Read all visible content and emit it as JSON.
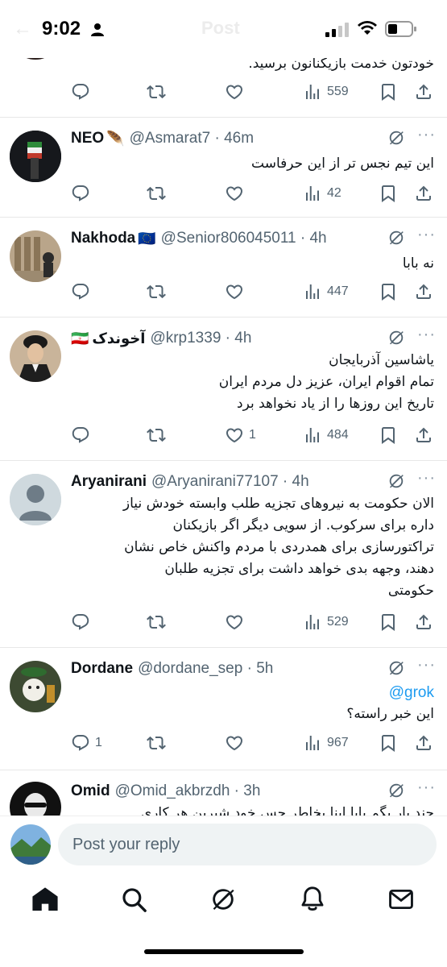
{
  "status_bar": {
    "time": "9:02",
    "faded_back": "←",
    "faded_title": "Post"
  },
  "tweets": [
    {
      "name": "",
      "badge": "",
      "handle": "",
      "time": "",
      "text": [
        "خودتون خدمت بازیکنانون برسید."
      ],
      "mention": "",
      "counts": {
        "replies": "",
        "reposts": "",
        "likes": "",
        "views": "559"
      }
    },
    {
      "name": "NEO",
      "badge": "🪶",
      "handle": "@Asmarat7",
      "time": "46m",
      "text": [
        "این تیم نجس تر از این حرفاست"
      ],
      "mention": "",
      "counts": {
        "replies": "",
        "reposts": "",
        "likes": "",
        "views": "42"
      }
    },
    {
      "name": "Nakhoda",
      "badge": "🇪🇺",
      "handle": "@Senior806045011",
      "time": "4h",
      "text": [
        "نه بابا"
      ],
      "mention": "",
      "counts": {
        "replies": "",
        "reposts": "",
        "likes": "",
        "views": "447"
      }
    },
    {
      "name": "آخوندک",
      "badge": "🇮🇷",
      "handle": "@krp1339",
      "time": "4h",
      "text": [
        "یاشاسین آذربایجان",
        "تمام اقوام ایران، عزیز دل مردم ایران",
        "تاریخ این روزها را از یاد نخواهد برد"
      ],
      "mention": "",
      "counts": {
        "replies": "",
        "reposts": "",
        "likes": "1",
        "views": "484"
      }
    },
    {
      "name": "Aryanirani",
      "badge": "",
      "handle": "@Aryanirani77107",
      "time": "4h",
      "text": [
        "الان حکومت به نیروهای تجزیه طلب وابسته خودش نیاز",
        "داره برای سرکوب. از سویی دیگر اگر بازیکنان",
        "تراکتورسازی برای همدردی با مردم واکنش خاص نشان",
        "دهند، وجهه بدی خواهد داشت برای تجزیه طلبان",
        "حکومتی"
      ],
      "mention": "",
      "counts": {
        "replies": "",
        "reposts": "",
        "likes": "",
        "views": "529"
      }
    },
    {
      "name": "Dordane",
      "badge": "",
      "handle": "@dordane_sep",
      "time": "5h",
      "text": [
        "این خبر راسته؟"
      ],
      "mention": "@grok",
      "counts": {
        "replies": "1",
        "reposts": "",
        "likes": "",
        "views": "967"
      }
    },
    {
      "name": "Omid",
      "badge": "",
      "handle": "@Omid_akbrzdh",
      "time": "3h",
      "text": [
        "چند بار بگم بابا اینا بخاطر حس خود شیرین هر کاری"
      ],
      "mention": "",
      "counts": {
        "replies": "",
        "reposts": "",
        "likes": "",
        "views": ""
      }
    }
  ],
  "reply_bar": {
    "placeholder": "Post your reply"
  },
  "tab_bar": {
    "items": [
      "home-icon",
      "search-icon",
      "grok-icon",
      "notifications-icon",
      "messages-icon"
    ]
  },
  "colors": {
    "accent": "#1d9bf0",
    "secondary_text": "#536471",
    "divider": "#e7e7e7"
  }
}
